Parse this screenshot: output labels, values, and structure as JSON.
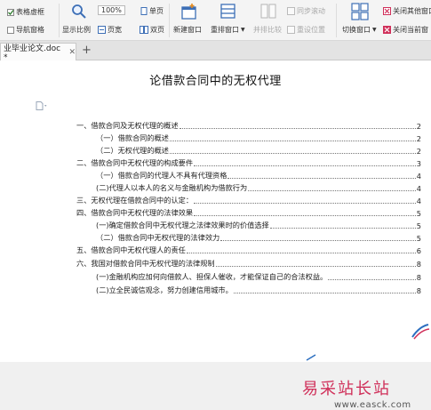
{
  "ribbon": {
    "ruler_label": "表格虚框",
    "nav_pane_label": "导航窗格",
    "zoom_value": "100%",
    "single_page_label": "单页",
    "show_ratio_label": "显示比例",
    "page_width_label": "页宽",
    "double_page_label": "双页",
    "new_window_label": "新建窗口",
    "rearrange_label": "重排窗口",
    "side_by_side_label": "并排比较",
    "sync_scroll_label": "同步滚动",
    "reset_position_label": "重设位置",
    "switch_window_label": "切换窗口",
    "close_others_label": "关闭其他窗口",
    "close_current_label": "关闭当前窗"
  },
  "tabs": {
    "active_label": "业毕业论文.doc *",
    "add_label": "+"
  },
  "document": {
    "title": "论借款合同中的无权代理",
    "toc": [
      {
        "text": "一、借款合同及无权代理的概述",
        "page": "2"
      },
      {
        "text": "（一）借款合同的概述",
        "page": "2"
      },
      {
        "text": "（二）无权代理的概述",
        "page": "2"
      },
      {
        "text": "二、借款合同中无权代理的构成要件",
        "page": "3"
      },
      {
        "text": "（一）借款合同的代理人不具有代理资格",
        "page": "4"
      },
      {
        "text": "(二)代理人以本人的名义与金融机构为借款行为",
        "page": "4"
      },
      {
        "text": "三、无权代理在借款合同中的认定：",
        "page": "4"
      },
      {
        "text": "四、借款合同中无权代理的法律效果",
        "page": "5"
      },
      {
        "text": "(一)确定借款合同中无权代理之法律效果时的价值选择",
        "page": "5"
      },
      {
        "text": "（二）借款合同中无权代理的法律效力",
        "page": "5"
      },
      {
        "text": "五、借款合同中无权代理人的责任",
        "page": "6"
      },
      {
        "text": "六、我国对借款合同中无权代理的法律规制",
        "page": "8"
      },
      {
        "text": "(一)金融机构应加何向借款人、担保人催收，才能保证自己的合法权益。",
        "page": "8"
      },
      {
        "text": "(二)立全民诚信观念，努力创建信用城市。",
        "page": "8"
      }
    ]
  },
  "watermark": {
    "brand": "易采站长站",
    "url": "www.easck.com"
  },
  "colors": {
    "accent_red": "#d0305a",
    "icon_blue": "#3d6fb6",
    "icon_orange": "#e38a1e"
  }
}
